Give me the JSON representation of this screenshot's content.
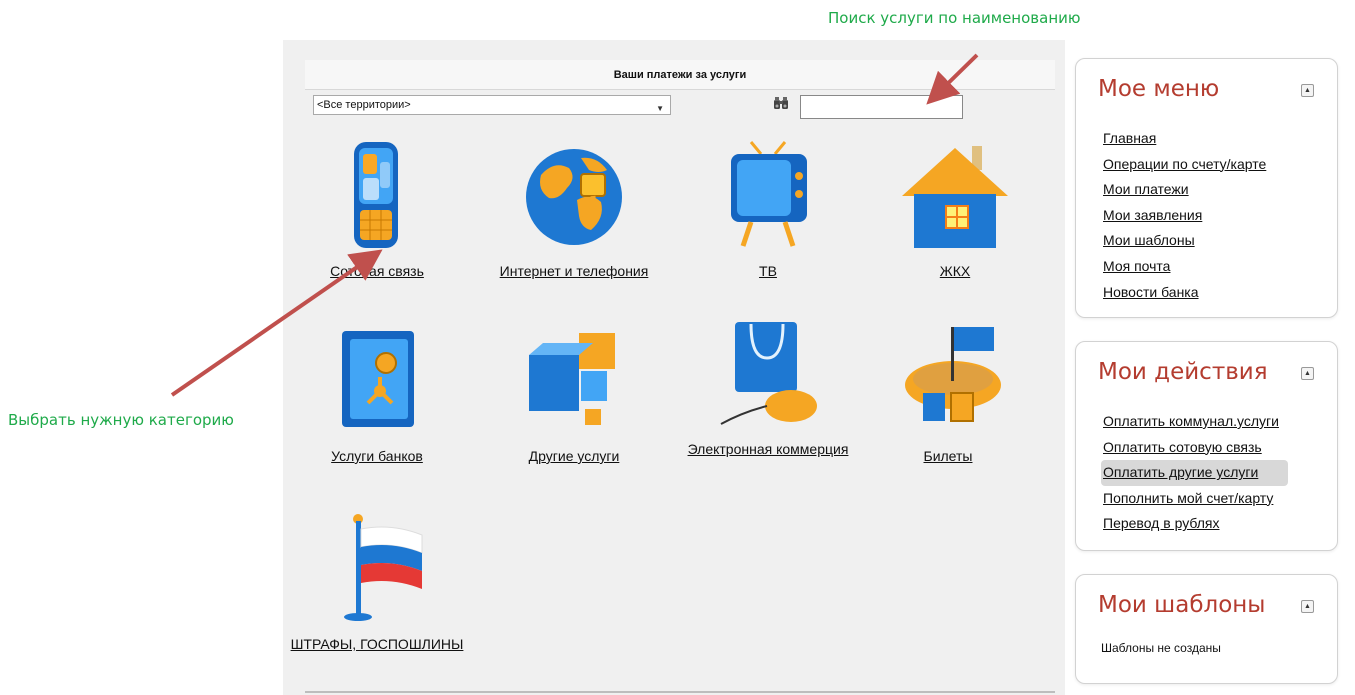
{
  "annotations": {
    "search_hint": "Поиск услуги по наименованию",
    "category_hint": "Выбрать нужную категорию"
  },
  "payments": {
    "header": "Ваши платежи за услуги",
    "territory_select": "<Все территории>",
    "search_value": "",
    "tiles": [
      {
        "label": "Сотовая связь",
        "icon": "mobile-phone-icon"
      },
      {
        "label": "Интернет и телефония",
        "icon": "globe-icon"
      },
      {
        "label": "ТВ",
        "icon": "tv-icon"
      },
      {
        "label": "ЖКХ",
        "icon": "house-icon"
      },
      {
        "label": "Услуги банков",
        "icon": "safe-icon"
      },
      {
        "label": "Другие услуги",
        "icon": "cubes-icon"
      },
      {
        "label": "Электронная коммерция",
        "icon": "shopping-bag-mouse-icon"
      },
      {
        "label": "Билеты",
        "icon": "ticket-flag-icon"
      },
      {
        "label": "ШТРАФЫ, ГОСПОШЛИНЫ",
        "icon": "russian-flag-icon"
      }
    ]
  },
  "my_menu": {
    "title": "Мое меню",
    "items": [
      "Главная",
      "Операции по счету/карте",
      "Мои платежи",
      "Мои заявления",
      "Мои шаблоны",
      "Моя почта",
      "Новости банка"
    ]
  },
  "my_actions": {
    "title": "Мои действия",
    "items": [
      "Оплатить коммунал.услуги",
      "Оплатить сотовую связь",
      "Оплатить другие услуги",
      "Пополнить мой счет/карту",
      "Перевод в рублях"
    ],
    "active_index": 2
  },
  "my_templates": {
    "title": "Мои шаблоны",
    "empty_text": "Шаблоны не созданы"
  },
  "colors": {
    "annotation_green": "#1faa4a",
    "arrow_red": "#c0504d",
    "sidebar_title": "#b43c2f",
    "icon_blue": "#1e78d2",
    "icon_orange": "#f5a623"
  }
}
